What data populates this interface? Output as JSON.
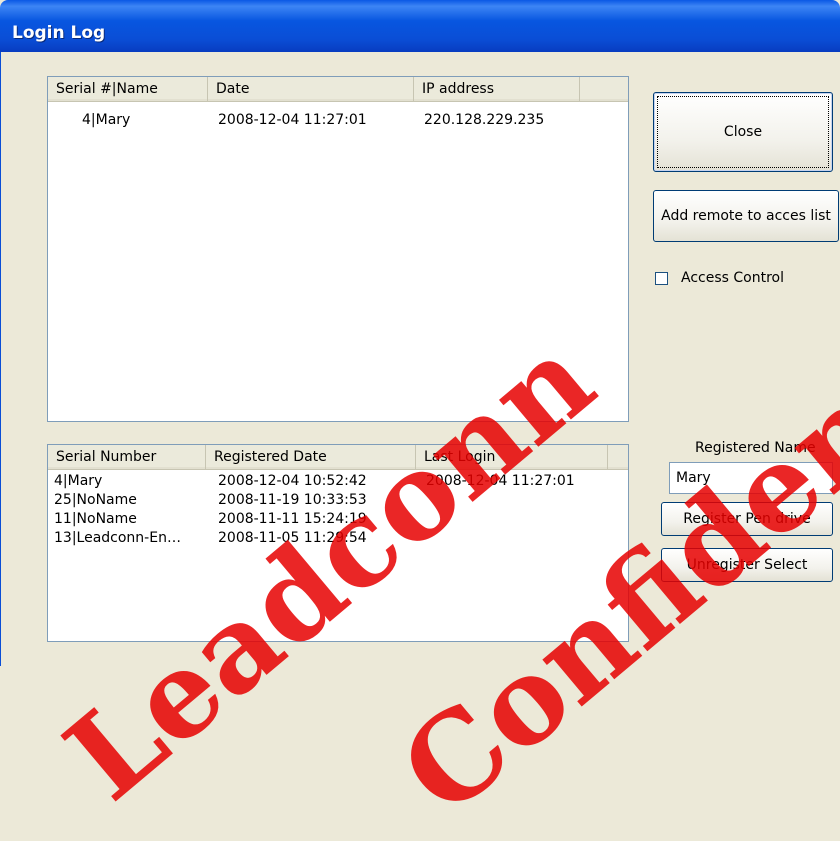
{
  "window": {
    "title": "Login Log"
  },
  "login_list": {
    "columns": [
      "Serial #|Name",
      "Date",
      "IP address"
    ],
    "rows": [
      {
        "serial_name": "4|Mary",
        "date": "2008-12-04 11:27:01",
        "ip": "220.128.229.235"
      }
    ]
  },
  "registered_list": {
    "columns": [
      "Serial Number",
      "Registered Date",
      "Last Login"
    ],
    "rows": [
      {
        "serial": "4|Mary",
        "registered_date": "2008-12-04 10:52:42",
        "last_login": "2008-12-04 11:27:01"
      },
      {
        "serial": "25|NoName",
        "registered_date": "2008-11-19 10:33:53",
        "last_login": ""
      },
      {
        "serial": "11|NoName",
        "registered_date": "2008-11-11 15:24:19",
        "last_login": ""
      },
      {
        "serial": "13|Leadconn-En…",
        "registered_date": "2008-11-05 11:29:54",
        "last_login": ""
      }
    ]
  },
  "buttons": {
    "close": "Close",
    "add_remote": "Add remote to acces list",
    "register_pen": "Register Pen drive",
    "unregister": "Unregister Select"
  },
  "access_control": {
    "label": "Access Control",
    "checked": false
  },
  "registered_name": {
    "label": "Registered Name",
    "value": "Mary"
  },
  "watermark": {
    "line1": "Leadconn",
    "line2": "Confidential",
    "color": "#E60000"
  },
  "colors": {
    "titlebar": "#0A4ED6",
    "face": "#ECE9D8",
    "button_border": "#003C74"
  }
}
